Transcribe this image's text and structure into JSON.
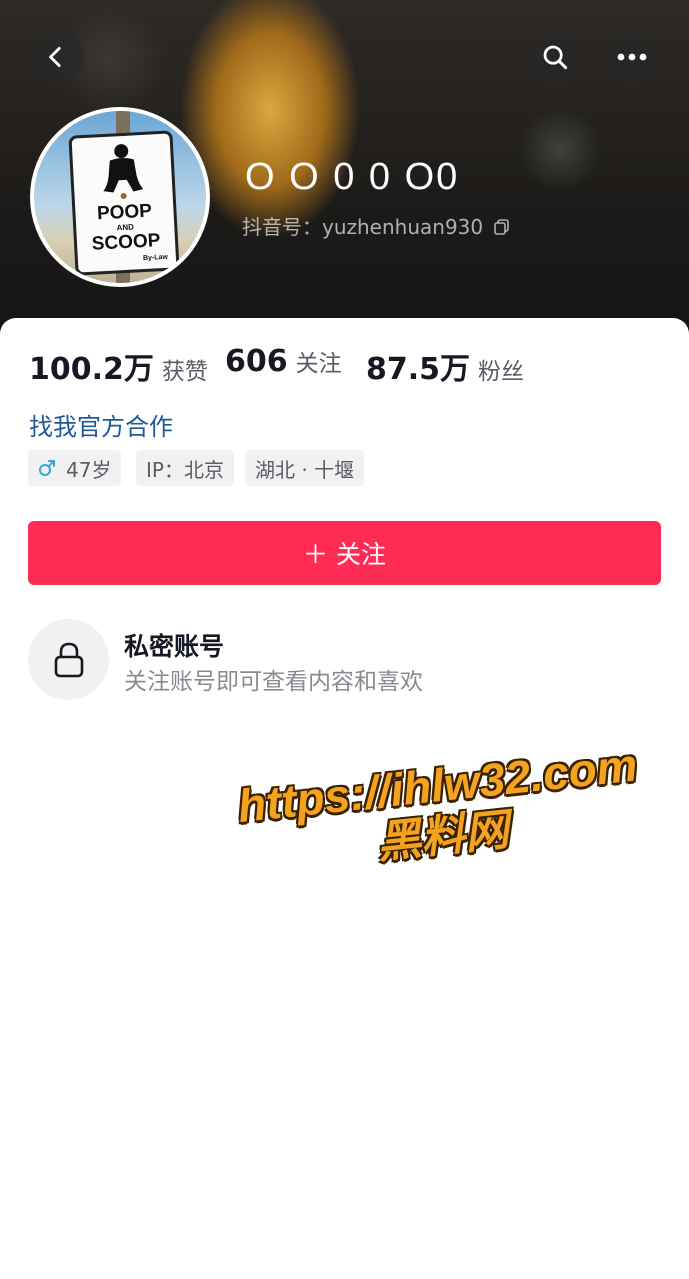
{
  "header": {
    "back_icon": "chevron-left-icon",
    "search_icon": "search-icon",
    "more_icon": "more-horizontal-icon"
  },
  "profile": {
    "nickname": "O O 0 0 O0",
    "douyin_id": "抖音号：yuzhenhuan930",
    "copy_icon": "copy-icon",
    "avatar_sign": {
      "line1": "POOP",
      "line2": "AND",
      "line3": "SCOOP",
      "line4": "By-Law"
    }
  },
  "stats": [
    {
      "value": "100.2万",
      "label": "获赞"
    },
    {
      "value": "606",
      "label": "关注"
    },
    {
      "value": "87.5万",
      "label": "粉丝"
    }
  ],
  "bio": {
    "business_link": "找我官方合作"
  },
  "tags": [
    {
      "icon": "male-icon",
      "text": "47岁"
    },
    {
      "text": "IP：北京"
    },
    {
      "text": "湖北 · 十堰"
    }
  ],
  "follow_button": {
    "label": "＋ 关注",
    "color": "#fe2c55"
  },
  "private": {
    "icon": "lock-icon",
    "title": "私密账号",
    "subtitle": "关注账号即可查看内容和喜欢"
  },
  "watermark": {
    "url": "https://ihlw32.com",
    "name": "黑料网"
  }
}
